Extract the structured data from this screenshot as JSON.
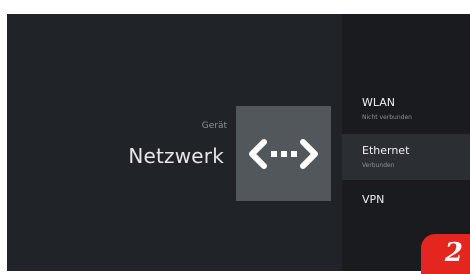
{
  "breadcrumb": "Gerät",
  "title": "Netzwerk",
  "hero_icon": "ethernet-icon",
  "menu": {
    "items": [
      {
        "label": "WLAN",
        "status": "Nicht verbunden"
      },
      {
        "label": "Ethernet",
        "status": "Verbunden"
      },
      {
        "label": "VPN",
        "status": ""
      }
    ],
    "focused_index": 1
  },
  "badge": {
    "text": "2"
  },
  "colors": {
    "background": "#202327",
    "panel": "#191b1e",
    "icon_tile": "#52575b",
    "badge": "#e4261f"
  }
}
